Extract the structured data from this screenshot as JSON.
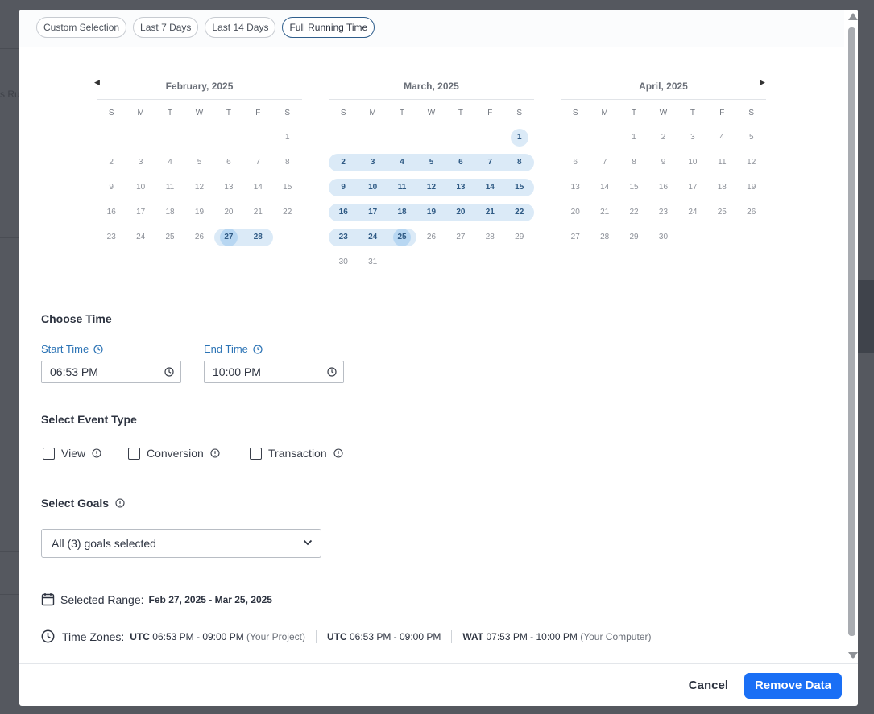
{
  "backdrop": {
    "ghost_text": "s Ru"
  },
  "presets": [
    {
      "label": "Custom Selection",
      "active": false
    },
    {
      "label": "Last 7 Days",
      "active": false
    },
    {
      "label": "Last 14 Days",
      "active": false
    },
    {
      "label": "Full Running Time",
      "active": true
    }
  ],
  "calendar": {
    "weekday_headers": [
      "S",
      "M",
      "T",
      "W",
      "T",
      "F",
      "S"
    ],
    "prev_icon": "triangle-left-icon",
    "next_icon": "triangle-right-icon",
    "months": [
      {
        "title": "February, 2025",
        "weeks": [
          [
            "",
            "",
            "",
            "",
            "",
            "",
            "1"
          ],
          [
            "2",
            "3",
            "4",
            "5",
            "6",
            "7",
            "8"
          ],
          [
            "9",
            "10",
            "11",
            "12",
            "13",
            "14",
            "15"
          ],
          [
            "16",
            "17",
            "18",
            "19",
            "20",
            "21",
            "22"
          ],
          [
            "23",
            "24",
            "25",
            "26",
            "27",
            "28",
            ""
          ]
        ]
      },
      {
        "title": "March, 2025",
        "weeks": [
          [
            "",
            "",
            "",
            "",
            "",
            "",
            "1"
          ],
          [
            "2",
            "3",
            "4",
            "5",
            "6",
            "7",
            "8"
          ],
          [
            "9",
            "10",
            "11",
            "12",
            "13",
            "14",
            "15"
          ],
          [
            "16",
            "17",
            "18",
            "19",
            "20",
            "21",
            "22"
          ],
          [
            "23",
            "24",
            "25",
            "26",
            "27",
            "28",
            "29"
          ],
          [
            "30",
            "31",
            "",
            "",
            "",
            "",
            ""
          ]
        ]
      },
      {
        "title": "April, 2025",
        "weeks": [
          [
            "",
            "",
            "1",
            "2",
            "3",
            "4",
            "5"
          ],
          [
            "6",
            "7",
            "8",
            "9",
            "10",
            "11",
            "12"
          ],
          [
            "13",
            "14",
            "15",
            "16",
            "17",
            "18",
            "19"
          ],
          [
            "20",
            "21",
            "22",
            "23",
            "24",
            "25",
            "26"
          ],
          [
            "27",
            "28",
            "29",
            "30",
            "",
            "",
            ""
          ]
        ]
      }
    ],
    "selected_start": "2025-02-27",
    "selected_end": "2025-03-25"
  },
  "choose_time": {
    "title": "Choose Time",
    "start_label": "Start Time",
    "start_value": "06:53 PM",
    "end_label": "End Time",
    "end_value": "10:00 PM"
  },
  "event_type": {
    "title": "Select Event Type",
    "options": [
      {
        "label": "View",
        "checked": false
      },
      {
        "label": "Conversion",
        "checked": false
      },
      {
        "label": "Transaction",
        "checked": false
      }
    ]
  },
  "goals": {
    "title": "Select Goals",
    "selected": "All (3) goals selected"
  },
  "summary": {
    "range_label": "Selected Range:",
    "range_value": "Feb 27, 2025 - Mar 25, 2025",
    "tz_label": "Time Zones:",
    "tz1_zone": "UTC",
    "tz1_time": "06:53 PM - 09:00 PM",
    "tz1_note": "(Your Project)",
    "tz2_zone": "UTC",
    "tz2_time": "06:53 PM - 09:00 PM",
    "tz3_zone": "WAT",
    "tz3_time": "07:53 PM - 10:00 PM",
    "tz3_note": "(Your Computer)"
  },
  "footer": {
    "cancel_label": "Cancel",
    "primary_label": "Remove Data"
  },
  "colors": {
    "accent": "#1a6ff5",
    "range_fill": "#dbeaf7",
    "range_edge": "#b8d7f2",
    "label_blue": "#2b73b5"
  }
}
